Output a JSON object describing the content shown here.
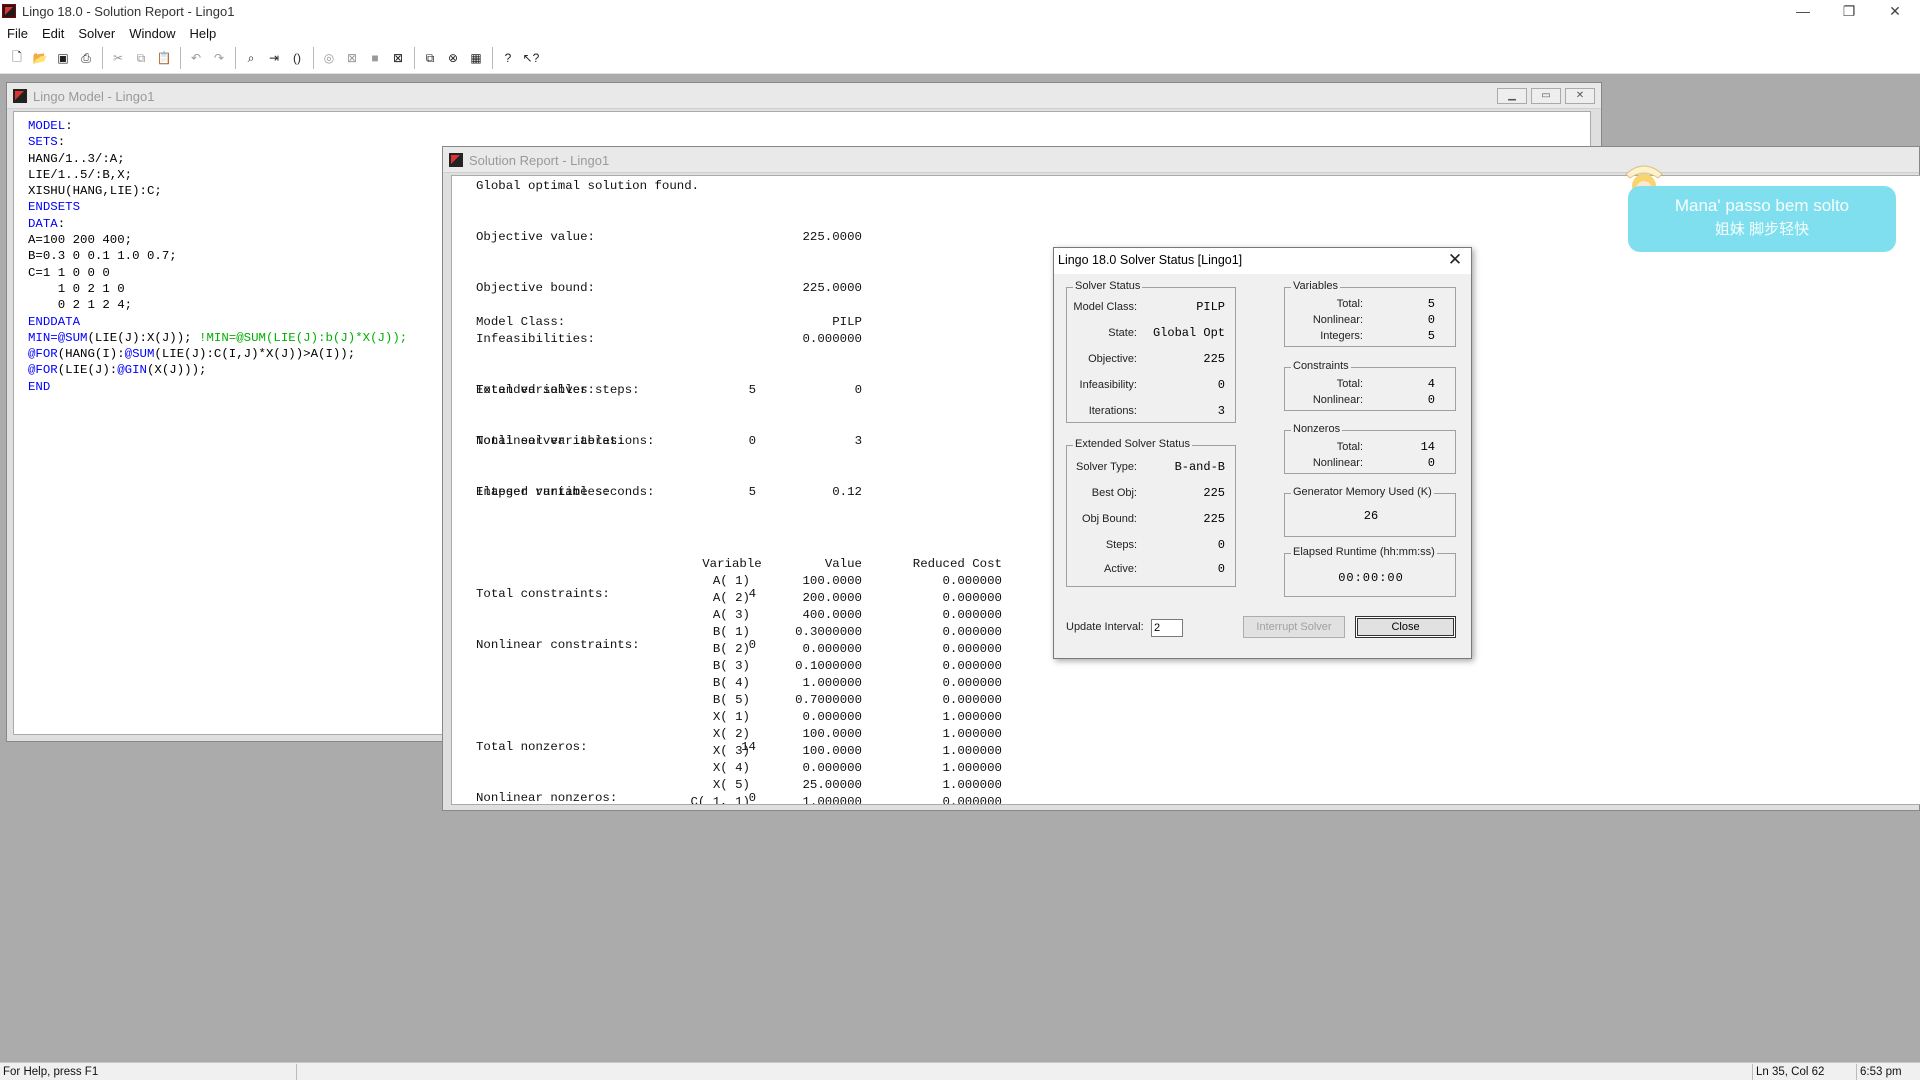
{
  "app": {
    "title": "Lingo 18.0 - Solution Report - Lingo1",
    "window_controls": {
      "minimize": "—",
      "restore": "❐",
      "close": "✕"
    }
  },
  "menu": [
    "File",
    "Edit",
    "Solver",
    "Window",
    "Help"
  ],
  "toolbar_icons": [
    "new-icon",
    "open-icon",
    "save-icon",
    "print-icon",
    "cut-icon",
    "copy-icon",
    "paste-icon",
    "undo-icon",
    "redo-icon",
    "find-icon",
    "goto-line-icon",
    "match-paren-icon",
    "solve-icon",
    "solution-icon",
    "look-icon",
    "options-icon",
    "send-to-back-icon",
    "close-all-icon",
    "tile-icon",
    "help-icon",
    "context-help-icon"
  ],
  "model_window": {
    "title": "Lingo Model - Lingo1",
    "lines": [
      [
        {
          "t": "MODEL",
          "c": "kw"
        },
        {
          "t": ":"
        }
      ],
      [
        {
          "t": "SETS",
          "c": "kw"
        },
        {
          "t": ":"
        }
      ],
      [
        {
          "t": "HANG/1..3/:A;"
        }
      ],
      [
        {
          "t": "LIE/1..5/:B,X;"
        }
      ],
      [
        {
          "t": "XISHU(HANG,LIE):C;"
        }
      ],
      [
        {
          "t": "ENDSETS",
          "c": "kw"
        }
      ],
      [
        {
          "t": "DATA",
          "c": "kw"
        },
        {
          "t": ":"
        }
      ],
      [
        {
          "t": "A=100 200 400;"
        }
      ],
      [
        {
          "t": "B=0.3 0 0.1 1.0 0.7;"
        }
      ],
      [
        {
          "t": "C=1 1 0 0 0"
        }
      ],
      [
        {
          "t": "    1 0 2 1 0"
        }
      ],
      [
        {
          "t": "    0 2 1 2 4;"
        }
      ],
      [
        {
          "t": "ENDDATA",
          "c": "kw"
        }
      ],
      [
        {
          "t": "MIN=@SUM",
          "c": "kw"
        },
        {
          "t": "(LIE(J):X(J)); "
        },
        {
          "t": "!MIN=@SUM(LIE(J):b(J)*X(J));",
          "c": "cm"
        }
      ],
      [
        {
          "t": "@FOR",
          "c": "kw"
        },
        {
          "t": "(HANG(I):"
        },
        {
          "t": "@SUM",
          "c": "kw"
        },
        {
          "t": "(LIE(J):C(I,J)*X(J))>A(I));"
        }
      ],
      [
        {
          "t": "@FOR",
          "c": "kw"
        },
        {
          "t": "(LIE(J):"
        },
        {
          "t": "@GIN",
          "c": "kw"
        },
        {
          "t": "(X(J)));"
        }
      ],
      [
        {
          "t": "END",
          "c": "kw"
        }
      ]
    ]
  },
  "report_window": {
    "title": "Solution Report - Lingo1",
    "headline": "Global optimal solution found.",
    "stats": [
      {
        "label": "Objective value:",
        "value": "225.0000"
      },
      {
        "label": "Objective bound:",
        "value": "225.0000"
      },
      {
        "label": "Infeasibilities:",
        "value": "0.000000"
      },
      {
        "label": "Extended solver steps:",
        "value": "0"
      },
      {
        "label": "Total solver iterations:",
        "value": "3"
      },
      {
        "label": "Elapsed runtime seconds:",
        "value": "0.12"
      }
    ],
    "model_class": {
      "label": "Model Class:",
      "value": "PILP"
    },
    "counts": [
      [
        {
          "label": "Total variables:",
          "value": "5"
        },
        {
          "label": "Nonlinear variables:",
          "value": "0"
        },
        {
          "label": "Integer variables:",
          "value": "5"
        }
      ],
      [
        {
          "label": "Total constraints:",
          "value": "4"
        },
        {
          "label": "Nonlinear constraints:",
          "value": "0"
        }
      ],
      [
        {
          "label": "Total nonzeros:",
          "value": "14"
        },
        {
          "label": "Nonlinear nonzeros:",
          "value": "0"
        }
      ]
    ],
    "table_headers": [
      "Variable",
      "Value",
      "Reduced Cost"
    ],
    "table_rows": [
      [
        "A( 1)",
        "100.0000",
        "0.000000"
      ],
      [
        "A( 2)",
        "200.0000",
        "0.000000"
      ],
      [
        "A( 3)",
        "400.0000",
        "0.000000"
      ],
      [
        "B( 1)",
        "0.3000000",
        "0.000000"
      ],
      [
        "B( 2)",
        "0.000000",
        "0.000000"
      ],
      [
        "B( 3)",
        "0.1000000",
        "0.000000"
      ],
      [
        "B( 4)",
        "1.000000",
        "0.000000"
      ],
      [
        "B( 5)",
        "0.7000000",
        "0.000000"
      ],
      [
        "X( 1)",
        "0.000000",
        "1.000000"
      ],
      [
        "X( 2)",
        "100.0000",
        "1.000000"
      ],
      [
        "X( 3)",
        "100.0000",
        "1.000000"
      ],
      [
        "X( 4)",
        "0.000000",
        "1.000000"
      ],
      [
        "X( 5)",
        "25.00000",
        "1.000000"
      ],
      [
        "C( 1, 1)",
        "1.000000",
        "0.000000"
      ]
    ]
  },
  "bubble": {
    "line1": "Mana' passo bem solto",
    "line2": "姐妹 脚步轻快"
  },
  "solver_dialog": {
    "title": "Lingo 18.0 Solver Status [Lingo1]",
    "solver_status": {
      "group": "Solver Status",
      "fields": [
        {
          "label": "Model Class:",
          "value": "PILP"
        },
        {
          "label": "State:",
          "value": "Global Opt"
        },
        {
          "label": "Objective:",
          "value": "225"
        },
        {
          "label": "Infeasibility:",
          "value": "0"
        },
        {
          "label": "Iterations:",
          "value": "3"
        }
      ]
    },
    "extended_status": {
      "group": "Extended Solver Status",
      "fields": [
        {
          "label": "Solver Type:",
          "value": "B-and-B"
        },
        {
          "label": "Best Obj:",
          "value": "225"
        },
        {
          "label": "Obj Bound:",
          "value": "225"
        },
        {
          "label": "Steps:",
          "value": "0"
        },
        {
          "label": "Active:",
          "value": "0"
        }
      ]
    },
    "variables": {
      "group": "Variables",
      "fields": [
        {
          "label": "Total:",
          "value": "5"
        },
        {
          "label": "Nonlinear:",
          "value": "0"
        },
        {
          "label": "Integers:",
          "value": "5"
        }
      ]
    },
    "constraints": {
      "group": "Constraints",
      "fields": [
        {
          "label": "Total:",
          "value": "4"
        },
        {
          "label": "Nonlinear:",
          "value": "0"
        }
      ]
    },
    "nonzeros": {
      "group": "Nonzeros",
      "fields": [
        {
          "label": "Total:",
          "value": "14"
        },
        {
          "label": "Nonlinear:",
          "value": "0"
        }
      ]
    },
    "memory": {
      "group": "Generator Memory Used (K)",
      "value": "26"
    },
    "runtime": {
      "group": "Elapsed Runtime (hh:mm:ss)",
      "value": "00:00:00"
    },
    "update_interval": {
      "label": "Update Interval:",
      "value": "2"
    },
    "buttons": {
      "interrupt": "Interrupt Solver",
      "close": "Close"
    }
  },
  "status_bar": {
    "help": "For Help, press F1",
    "position": "Ln 35, Col 62",
    "time": "6:53 pm"
  }
}
